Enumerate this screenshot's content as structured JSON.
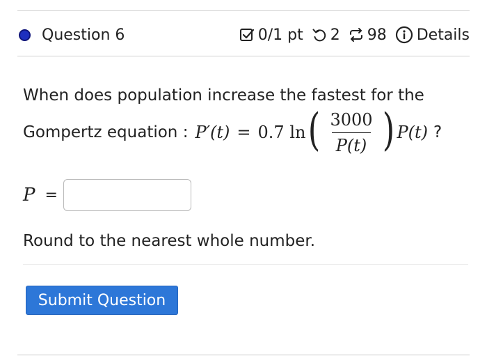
{
  "header": {
    "question_label": "Question 6",
    "score": "0/1 pt",
    "attempts": "2",
    "remaining": "98",
    "details_label": "Details",
    "colors": {
      "question_dot": "#1e2fbf"
    },
    "icons": [
      "checkbox-icon",
      "undo-icon",
      "repeat-icon",
      "info-icon"
    ]
  },
  "question": {
    "text": "When does population increase the fastest for the",
    "prefix": "Gompertz equation :",
    "formula": {
      "lhs": "P′(t)",
      "equals": "=",
      "coefficient": "0.7 ln",
      "numerator": "3000",
      "denominator": "P(t)",
      "rhs_factor": "P(t)"
    },
    "suffix": "?"
  },
  "answer": {
    "variable": "P",
    "equals": "=",
    "value": "",
    "placeholder": ""
  },
  "instruction": "Round to the nearest whole number.",
  "submit": {
    "label": "Submit Question",
    "color": "#2d77d8"
  }
}
